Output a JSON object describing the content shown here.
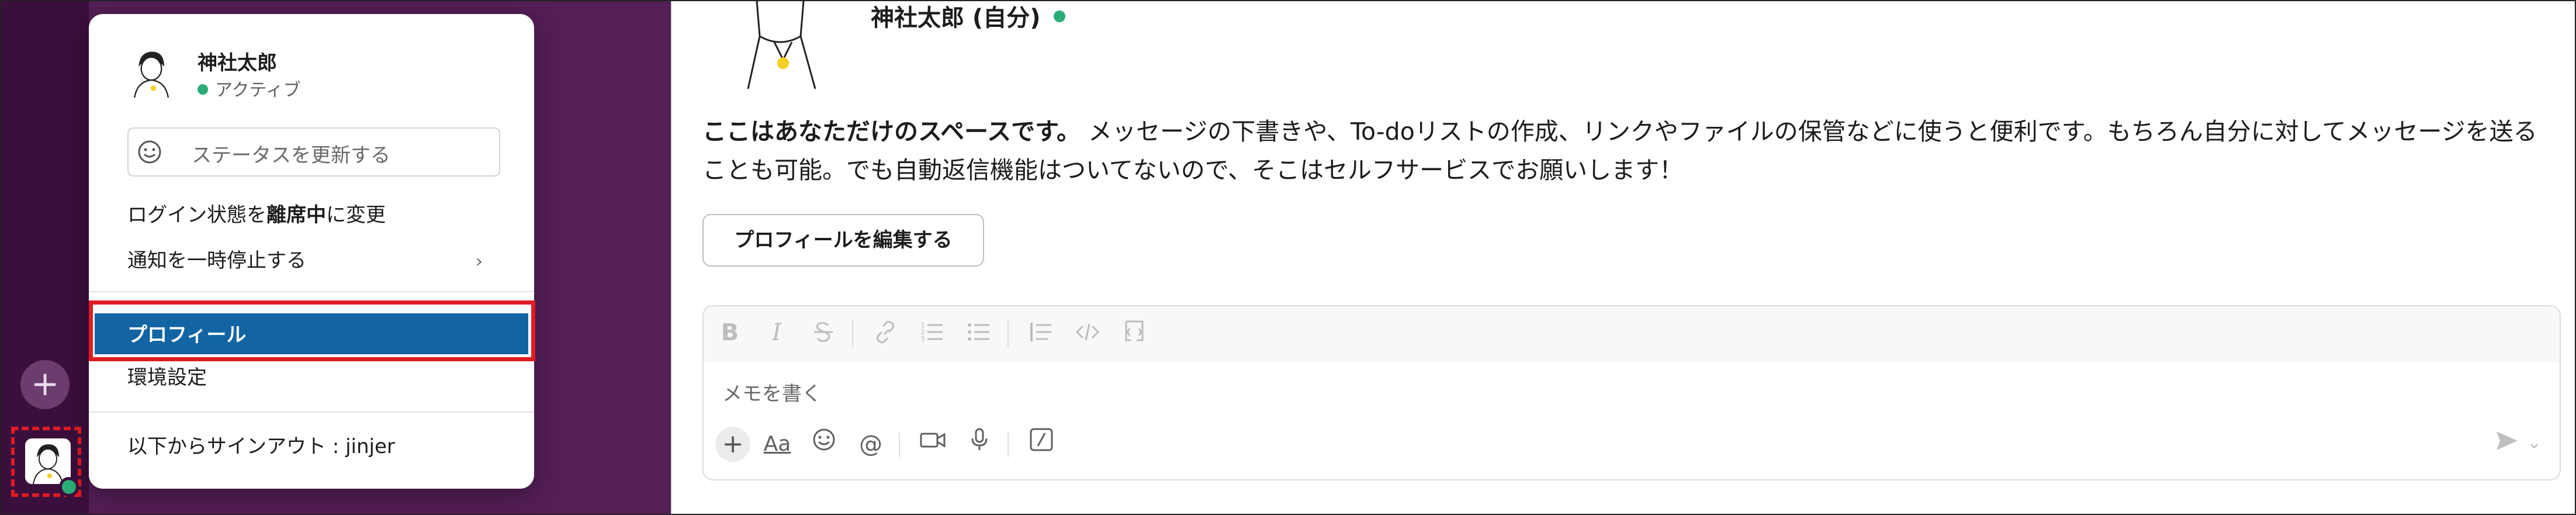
{
  "user": {
    "name": "神社太郎",
    "status": "アクティブ",
    "self_name": "神社太郎 (自分)"
  },
  "menu": {
    "status_placeholder": "ステータスを更新する",
    "away_prefix": "ログイン状態を",
    "away_bold": "離席中",
    "away_suffix": "に変更",
    "pause_notifications": "通知を一時停止する",
    "profile": "プロフィール",
    "preferences": "環境設定",
    "signout": "以下からサインアウト : jinjer"
  },
  "main": {
    "intro_bold": "ここはあなただけのスペースです。",
    "intro_text": " メッセージの下書きや、To-doリストの作成、リンクやファイルの保管などに使うと便利です。もちろん自分に対してメッセージを送ることも可能。でも自動返信機能はついてないので、そこはセルフサービスでお願いします！",
    "edit_profile": "プロフィールを編集する",
    "composer_placeholder": "メモを書く"
  },
  "composer": {
    "format_icons": [
      "bold-icon",
      "italic-icon",
      "strikethrough-icon",
      "link-icon",
      "ordered-list-icon",
      "bulleted-list-icon",
      "blockquote-icon",
      "code-icon",
      "code-block-icon"
    ],
    "tool_icons": [
      "plus-icon",
      "text-format-icon",
      "emoji-icon",
      "mention-icon",
      "video-icon",
      "microphone-icon",
      "slash-command-icon",
      "send-icon"
    ],
    "format_bold": "B",
    "format_italic": "I",
    "text_format": "Aa"
  },
  "colors": {
    "sidebar": "#541e56",
    "rail": "#3b0f3c",
    "highlight": "#1264a3",
    "annotation": "#e01b24",
    "presence": "#2bac76"
  }
}
